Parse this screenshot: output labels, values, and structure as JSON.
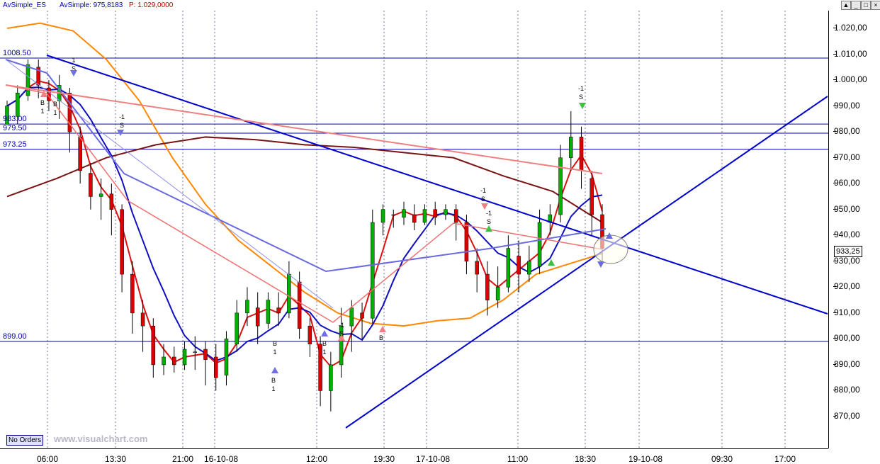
{
  "window": {
    "symbol": "AvSimple_ES",
    "indicator": "AvSimple: 975,8183",
    "pvalue": "P: 1.029,0000",
    "buttons": [
      "▲",
      "_",
      "□",
      "×"
    ]
  },
  "axis": {
    "y_ticks": [
      "1.020,00",
      "1.010,00",
      "1.000,00",
      "990,00",
      "980,00",
      "970,00",
      "960,00",
      "950,00",
      "940,00",
      "930,00",
      "920,00",
      "910,00",
      "900,00",
      "890,00",
      "880,00",
      "870,00"
    ],
    "x_ticks": [
      "06:00",
      "13:30",
      "21:00",
      "16-10-08",
      "12:00",
      "19:30",
      "17-10-08",
      "11:00",
      "18:30",
      "19-10-08",
      "09:30",
      "17:00"
    ],
    "last_price": "933,25"
  },
  "levels": [
    {
      "label": "1008.50",
      "value": 1008.5
    },
    {
      "label": "983.00",
      "value": 983.0
    },
    {
      "label": "979.50",
      "value": 979.5
    },
    {
      "label": "973.25",
      "value": 973.25
    },
    {
      "label": "899.00",
      "value": 899.0
    }
  ],
  "badges": {
    "no_orders": "No Orders"
  },
  "watermark": "www.visualchart.com",
  "signals": [
    {
      "lines": [
        "B",
        "1"
      ]
    },
    {
      "lines": [
        "B",
        "1"
      ]
    },
    {
      "lines": [
        "1",
        "S"
      ]
    },
    {
      "lines": [
        "-1",
        "S"
      ]
    },
    {
      "lines": [
        "B",
        "1"
      ]
    },
    {
      "lines": [
        "B",
        "1"
      ]
    },
    {
      "lines": [
        "B",
        "1"
      ]
    },
    {
      "lines": [
        "-1",
        "S"
      ]
    },
    {
      "lines": [
        "B"
      ]
    },
    {
      "lines": [
        "-1",
        "S"
      ]
    },
    {
      "lines": [
        "-1",
        "S"
      ]
    },
    {
      "lines": [
        "-1",
        "S"
      ]
    }
  ],
  "colors": {
    "trendline": "#0000cc",
    "candle_up": "#00b000",
    "candle_down": "#dd0000",
    "ma_orange": "#ff8800",
    "ma_brown": "#7a1414",
    "ma_red": "#dd1010"
  },
  "chart_data": {
    "type": "candlestick",
    "ylim": [
      862,
      1027
    ],
    "ma_series": [
      {
        "points": [
          [
            0,
            1020
          ],
          [
            10,
            1022
          ],
          [
            20,
            1019
          ],
          [
            30,
            1008
          ],
          [
            40,
            992
          ],
          [
            50,
            970
          ],
          [
            60,
            952
          ],
          [
            70,
            938
          ],
          [
            80,
            928
          ],
          [
            90,
            918
          ],
          [
            100,
            910
          ],
          [
            110,
            906
          ],
          [
            120,
            905
          ],
          [
            130,
            907
          ],
          [
            140,
            908
          ],
          [
            150,
            915
          ],
          [
            160,
            925
          ],
          [
            170,
            929
          ],
          [
            180,
            933
          ]
        ]
      },
      {
        "points": [
          [
            0,
            955
          ],
          [
            15,
            962
          ],
          [
            30,
            970
          ],
          [
            45,
            975
          ],
          [
            60,
            978
          ],
          [
            75,
            977
          ],
          [
            90,
            975
          ],
          [
            105,
            974
          ],
          [
            120,
            972
          ],
          [
            135,
            970
          ],
          [
            150,
            963
          ],
          [
            165,
            957
          ],
          [
            180,
            945
          ]
        ]
      }
    ],
    "candles": [
      [
        983,
        990,
        985,
        992
      ],
      [
        986,
        995,
        983,
        998
      ],
      [
        994,
        1006,
        992,
        1008
      ],
      [
        1005,
        998,
        993,
        1008
      ],
      [
        997,
        992,
        988,
        1000
      ],
      [
        992,
        998,
        985,
        1002
      ],
      [
        995,
        980,
        972,
        997
      ],
      [
        978,
        965,
        960,
        982
      ],
      [
        964,
        955,
        950,
        968
      ],
      [
        955,
        956,
        946,
        962
      ],
      [
        956,
        950,
        940,
        960
      ],
      [
        950,
        925,
        918,
        952
      ],
      [
        925,
        910,
        902,
        930
      ],
      [
        910,
        905,
        895,
        915
      ],
      [
        905,
        890,
        885,
        908
      ],
      [
        890,
        893,
        886,
        898
      ],
      [
        893,
        890,
        887,
        897
      ],
      [
        890,
        896,
        888,
        899
      ],
      [
        895,
        895,
        888,
        901
      ],
      [
        896,
        892,
        882,
        899
      ],
      [
        893,
        885,
        880,
        898
      ],
      [
        886,
        900,
        882,
        903
      ],
      [
        898,
        910,
        895,
        915
      ],
      [
        910,
        915,
        905,
        920
      ],
      [
        912,
        905,
        898,
        918
      ],
      [
        906,
        915,
        904,
        918
      ],
      [
        912,
        910,
        905,
        918
      ],
      [
        910,
        925,
        908,
        930
      ],
      [
        922,
        904,
        900,
        926
      ],
      [
        905,
        898,
        893,
        908
      ],
      [
        898,
        880,
        874,
        901
      ],
      [
        880,
        890,
        872,
        895
      ],
      [
        890,
        905,
        885,
        912
      ],
      [
        905,
        912,
        895,
        915
      ],
      [
        910,
        908,
        900,
        914
      ],
      [
        908,
        945,
        906,
        950
      ],
      [
        945,
        950,
        940,
        952
      ],
      [
        948,
        948,
        943,
        950
      ],
      [
        947,
        950,
        944,
        953
      ],
      [
        948,
        945,
        942,
        952
      ],
      [
        945,
        950,
        944,
        952
      ],
      [
        950,
        947,
        944,
        953
      ],
      [
        948,
        950,
        946,
        952
      ],
      [
        950,
        945,
        938,
        952
      ],
      [
        945,
        930,
        925,
        948
      ],
      [
        930,
        925,
        918,
        935
      ],
      [
        925,
        915,
        909,
        930
      ],
      [
        915,
        920,
        912,
        928
      ],
      [
        920,
        935,
        918,
        940
      ],
      [
        932,
        925,
        918,
        938
      ],
      [
        925,
        930,
        922,
        936
      ],
      [
        928,
        945,
        925,
        950
      ],
      [
        945,
        948,
        940,
        952
      ],
      [
        948,
        970,
        945,
        975
      ],
      [
        970,
        978,
        965,
        988
      ],
      [
        978,
        965,
        958,
        982
      ],
      [
        962,
        948,
        940,
        965
      ],
      [
        948,
        935,
        930,
        952
      ]
    ]
  }
}
